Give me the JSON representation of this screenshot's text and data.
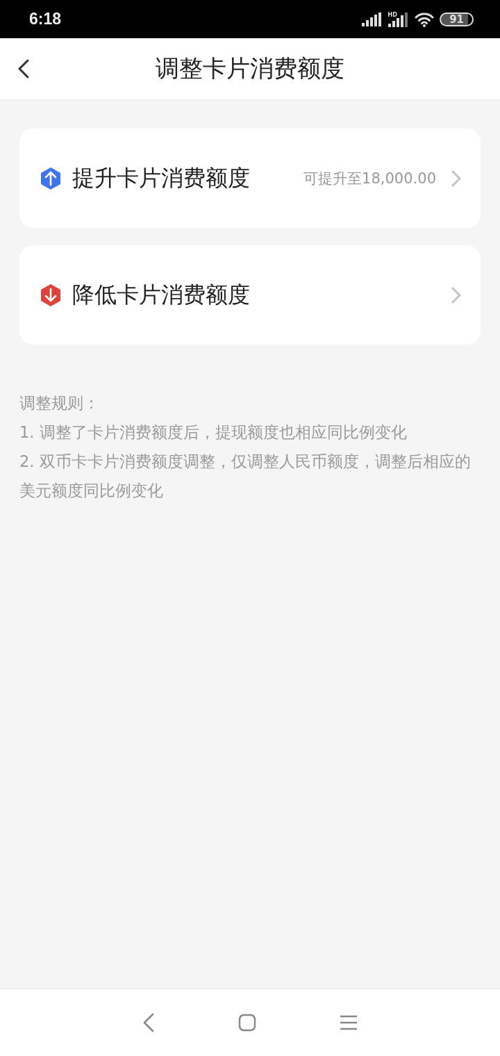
{
  "status_bar": {
    "time": "6:18",
    "battery": "91"
  },
  "header": {
    "title": "调整卡片消费额度"
  },
  "options": [
    {
      "kind": "up",
      "color": "#3f74f0",
      "label": "提升卡片消费额度",
      "hint": "可提升至18,000.00"
    },
    {
      "kind": "down",
      "color": "#e0413a",
      "label": "降低卡片消费额度"
    }
  ],
  "rules": {
    "title": "调整规则：",
    "items": [
      "1. 调整了卡片消费额度后，提现额度也相应同比例变化",
      "2. 双币卡卡片消费额度调整，仅调整人民币额度，调整后相应的美元额度同比例变化"
    ]
  }
}
